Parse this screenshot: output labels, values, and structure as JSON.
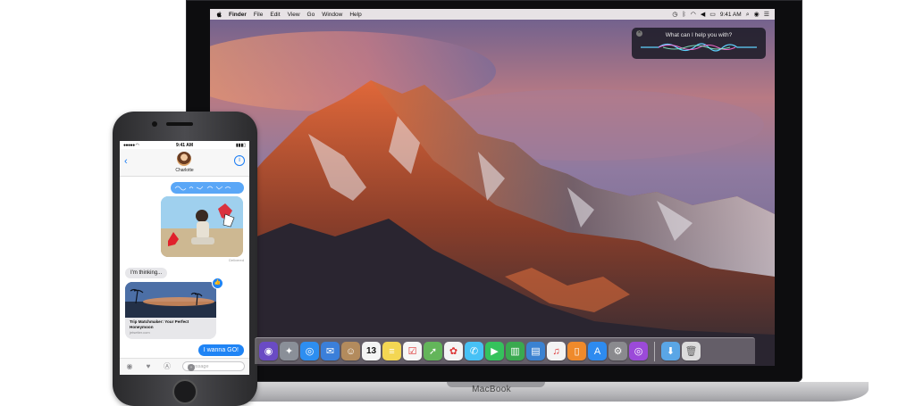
{
  "menubar": {
    "app_name": "Finder",
    "menus": [
      "File",
      "Edit",
      "View",
      "Go",
      "Window",
      "Help"
    ],
    "time": "9:41 AM"
  },
  "siri": {
    "prompt": "What can I help you with?"
  },
  "dock": {
    "apps": [
      {
        "name": "siri",
        "color": "#6a4bc4"
      },
      {
        "name": "launchpad",
        "color": "#8a8f98"
      },
      {
        "name": "safari",
        "color": "#2d8ef0"
      },
      {
        "name": "mail",
        "color": "#3b7fd9"
      },
      {
        "name": "contacts",
        "color": "#b38b5d"
      },
      {
        "name": "calendar",
        "color": "#f4f4f4"
      },
      {
        "name": "notes",
        "color": "#f3d653"
      },
      {
        "name": "reminders",
        "color": "#f6f6f6"
      },
      {
        "name": "maps",
        "color": "#63b55a"
      },
      {
        "name": "photos",
        "color": "#f4f4f4"
      },
      {
        "name": "messages",
        "color": "#47c1f5"
      },
      {
        "name": "facetime",
        "color": "#35c25c"
      },
      {
        "name": "numbers",
        "color": "#3aa94f"
      },
      {
        "name": "keynote",
        "color": "#3b82d1"
      },
      {
        "name": "itunes",
        "color": "#f3f3f3"
      },
      {
        "name": "ibooks",
        "color": "#ef8a2b"
      },
      {
        "name": "app-store",
        "color": "#2e8bf0"
      },
      {
        "name": "system-preferences",
        "color": "#8a8a8e"
      },
      {
        "name": "podcasts",
        "color": "#9b4ad9"
      }
    ],
    "folders": [
      {
        "name": "downloads",
        "color": "#5aa6e6"
      },
      {
        "name": "trash",
        "color": "#dcdcdc"
      }
    ],
    "calendar_day": "13"
  },
  "macbook": {
    "label": "MacBook"
  },
  "phone": {
    "time": "9:41 AM",
    "contact_name": "Charlotte",
    "messages": {
      "thinking": "I'm thinking...",
      "reply": "I wanna GO!"
    },
    "link": {
      "title": "Trip Matchmaker: Your Perfect Honeymoon",
      "domain": "jetsetter.com"
    },
    "delivered": "Delivered",
    "input_placeholder": "iMessage"
  }
}
